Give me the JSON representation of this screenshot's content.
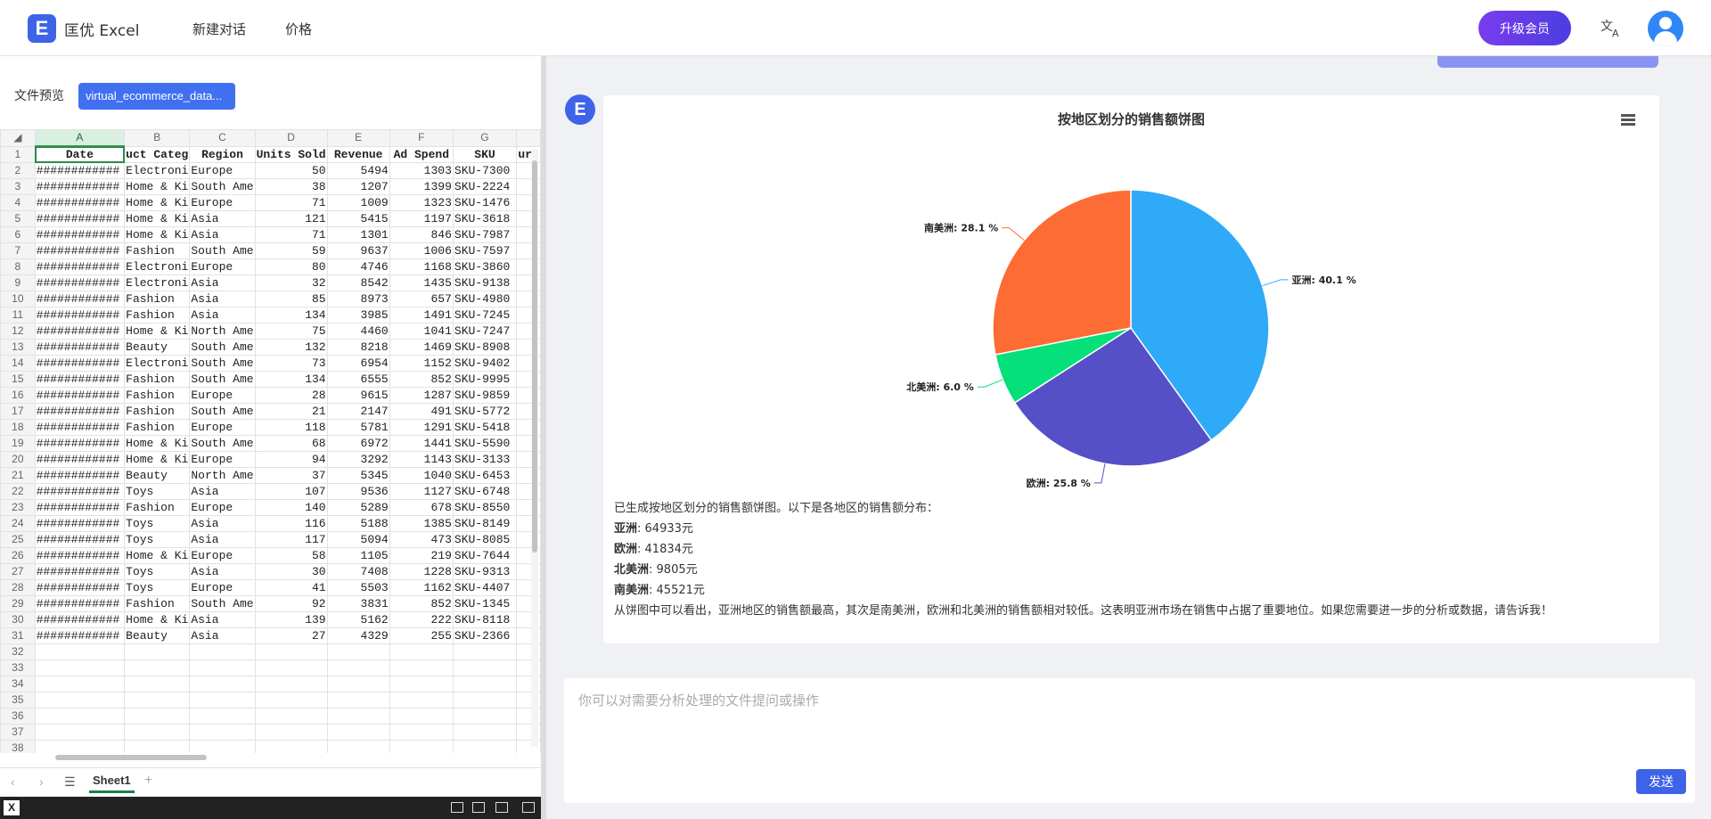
{
  "app": {
    "logo_letter": "E",
    "logo_text": "匡优 Excel",
    "nav": [
      "新建对话",
      "价格"
    ],
    "upgrade_label": "升级会员",
    "lang_icon": "translate-icon",
    "accent": "#3f63e8"
  },
  "preview": {
    "label": "文件预览",
    "file_name": "virtual_ecommerce_data..."
  },
  "sheet": {
    "columns": [
      "A",
      "B",
      "C",
      "D",
      "E",
      "F",
      "G",
      ""
    ],
    "header_row": [
      "Date",
      "uct Categ",
      "Region",
      "Units Sold",
      "Revenue",
      "Ad Spend",
      "SKU",
      "urr"
    ],
    "rows": [
      [
        "############",
        "Electroni",
        "Europe",
        "50",
        "5494",
        "1303",
        "SKU-7300"
      ],
      [
        "############",
        "Home & Ki",
        "South Ame",
        "38",
        "1207",
        "1399",
        "SKU-2224"
      ],
      [
        "############",
        "Home & Ki",
        "Europe",
        "71",
        "1009",
        "1323",
        "SKU-1476"
      ],
      [
        "############",
        "Home & Ki",
        "Asia",
        "121",
        "5415",
        "1197",
        "SKU-3618"
      ],
      [
        "############",
        "Home & Ki",
        "Asia",
        "71",
        "1301",
        "846",
        "SKU-7987"
      ],
      [
        "############",
        "Fashion",
        "South Ame",
        "59",
        "9637",
        "1006",
        "SKU-7597"
      ],
      [
        "############",
        "Electroni",
        "Europe",
        "80",
        "4746",
        "1168",
        "SKU-3860"
      ],
      [
        "############",
        "Electroni",
        "Asia",
        "32",
        "8542",
        "1435",
        "SKU-9138"
      ],
      [
        "############",
        "Fashion",
        "Asia",
        "85",
        "8973",
        "657",
        "SKU-4980"
      ],
      [
        "############",
        "Fashion",
        "Asia",
        "134",
        "3985",
        "1491",
        "SKU-7245"
      ],
      [
        "############",
        "Home & Ki",
        "North Ame",
        "75",
        "4460",
        "1041",
        "SKU-7247"
      ],
      [
        "############",
        "Beauty",
        "South Ame",
        "132",
        "8218",
        "1469",
        "SKU-8908"
      ],
      [
        "############",
        "Electroni",
        "South Ame",
        "73",
        "6954",
        "1152",
        "SKU-9402"
      ],
      [
        "############",
        "Fashion",
        "South Ame",
        "134",
        "6555",
        "852",
        "SKU-9995"
      ],
      [
        "############",
        "Fashion",
        "Europe",
        "28",
        "9615",
        "1287",
        "SKU-9859"
      ],
      [
        "############",
        "Fashion",
        "South Ame",
        "21",
        "2147",
        "491",
        "SKU-5772"
      ],
      [
        "############",
        "Fashion",
        "Europe",
        "118",
        "5781",
        "1291",
        "SKU-5418"
      ],
      [
        "############",
        "Home & Ki",
        "South Ame",
        "68",
        "6972",
        "1441",
        "SKU-5590"
      ],
      [
        "############",
        "Home & Ki",
        "Europe",
        "94",
        "3292",
        "1143",
        "SKU-3133"
      ],
      [
        "############",
        "Beauty",
        "North Ame",
        "37",
        "5345",
        "1040",
        "SKU-6453"
      ],
      [
        "############",
        "Toys",
        "Asia",
        "107",
        "9536",
        "1127",
        "SKU-6748"
      ],
      [
        "############",
        "Fashion",
        "Europe",
        "140",
        "5289",
        "678",
        "SKU-8550"
      ],
      [
        "############",
        "Toys",
        "Asia",
        "116",
        "5188",
        "1385",
        "SKU-8149"
      ],
      [
        "############",
        "Toys",
        "Asia",
        "117",
        "5094",
        "473",
        "SKU-8085"
      ],
      [
        "############",
        "Home & Ki",
        "Europe",
        "58",
        "1105",
        "219",
        "SKU-7644"
      ],
      [
        "############",
        "Toys",
        "Asia",
        "30",
        "7408",
        "1228",
        "SKU-9313"
      ],
      [
        "############",
        "Toys",
        "Europe",
        "41",
        "5503",
        "1162",
        "SKU-4407"
      ],
      [
        "############",
        "Fashion",
        "South Ame",
        "92",
        "3831",
        "852",
        "SKU-1345"
      ],
      [
        "############",
        "Home & Ki",
        "Asia",
        "139",
        "5162",
        "222",
        "SKU-8118"
      ],
      [
        "############",
        "Beauty",
        "Asia",
        "27",
        "4329",
        "255",
        "SKU-2366"
      ]
    ],
    "empty_row_numbers": [
      32,
      33,
      34,
      35,
      36,
      37,
      38
    ],
    "tab_name": "Sheet1"
  },
  "chart_data": {
    "type": "pie",
    "title": "按地区划分的销售额饼图",
    "slices": [
      {
        "name": "亚洲",
        "label": "亚洲: 40.1 %",
        "value": 40.1,
        "color": "#2eaaf8"
      },
      {
        "name": "欧洲",
        "label": "欧洲: 25.8 %",
        "value": 25.8,
        "color": "#554fc8"
      },
      {
        "name": "北美洲",
        "label": "北美洲: 6.0 %",
        "value": 6.0,
        "color": "#06e07a"
      },
      {
        "name": "南美洲",
        "label": "南美洲: 28.1 %",
        "value": 28.1,
        "color": "#fd6c34"
      }
    ]
  },
  "answer": {
    "intro": "已生成按地区划分的销售额饼图。以下是各地区的销售额分布：",
    "items": [
      {
        "region": "亚洲",
        "value": ": 64933元"
      },
      {
        "region": "欧洲",
        "value": ": 41834元"
      },
      {
        "region": "北美洲",
        "value": ": 9805元"
      },
      {
        "region": "南美洲",
        "value": ": 45521元"
      }
    ],
    "conclusion": "从饼图中可以看出，亚洲地区的销售额最高，其次是南美洲，欧洲和北美洲的销售额相对较低。这表明亚洲市场在销售中占据了重要地位。如果您需要进一步的分析或数据，请告诉我！"
  },
  "input": {
    "placeholder": "你可以对需要分析处理的文件提问或操作",
    "send_label": "发送"
  }
}
